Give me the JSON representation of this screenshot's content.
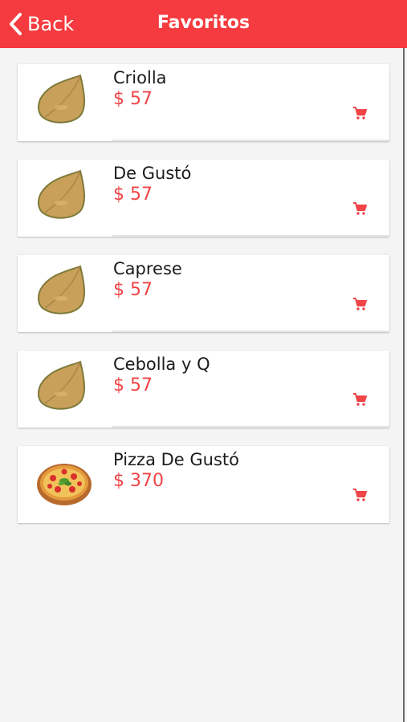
{
  "header": {
    "back_label": "Back",
    "title": "Favoritos",
    "color": "#f53b3f"
  },
  "items": [
    {
      "name": "Criolla",
      "price": "$ 57",
      "image": "empanada"
    },
    {
      "name": "De Gustó",
      "price": "$ 57",
      "image": "empanada"
    },
    {
      "name": "Caprese",
      "price": "$ 57",
      "image": "empanada"
    },
    {
      "name": "Cebolla y Q",
      "price": "$ 57",
      "image": "empanada"
    },
    {
      "name": "Pizza De Gustó",
      "price": "$ 370",
      "image": "pizza"
    }
  ],
  "icons": {
    "back": "chevron-left-icon",
    "cart": "cart-icon"
  },
  "colors": {
    "accent": "#f53b3f",
    "price": "#f04447"
  }
}
